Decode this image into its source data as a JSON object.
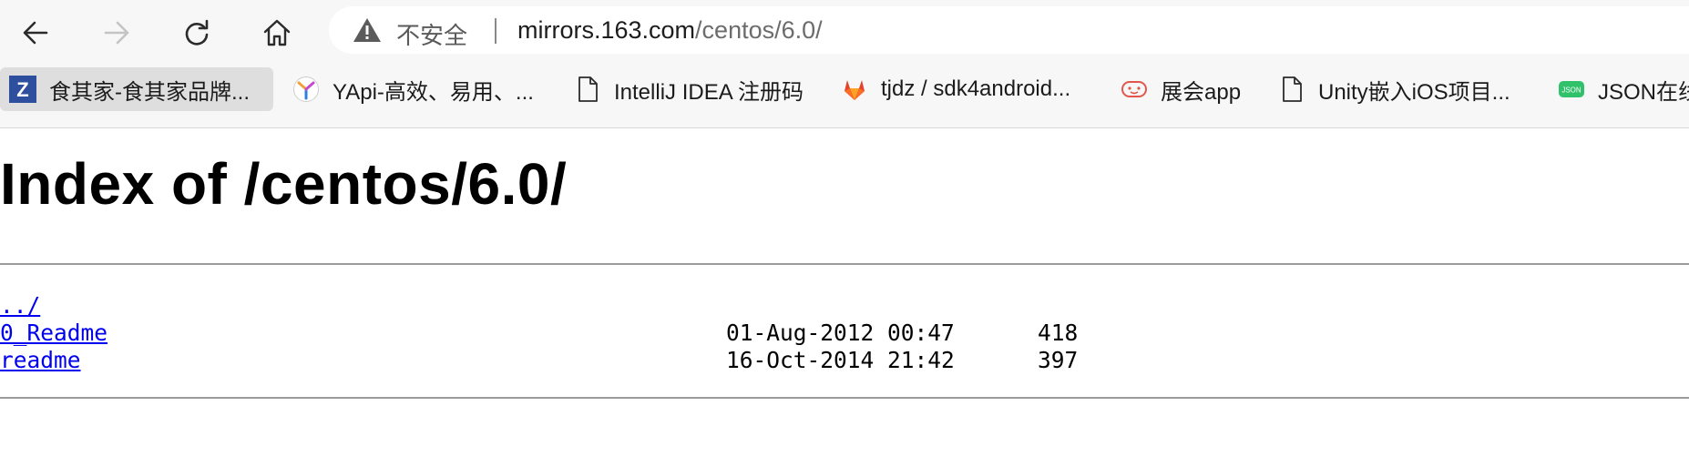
{
  "browser": {
    "security_label": "不安全",
    "url_host": "mirrors.163.com",
    "url_path": "/centos/6.0/"
  },
  "bookmarks": [
    {
      "label": "食其家-食其家品牌...",
      "icon": "z-logo-icon",
      "icon_color": "#2d4f9e"
    },
    {
      "label": "YApi-高效、易用、...",
      "icon": "yapi-logo-icon"
    },
    {
      "label": "IntelliJ IDEA 注册码",
      "icon": "page-icon"
    },
    {
      "label": "tjdz / sdk4android...",
      "icon": "gitlab-icon",
      "icon_color": "#e24329"
    },
    {
      "label": "展会app",
      "icon": "face-icon",
      "icon_color": "#e2574c"
    },
    {
      "label": "Unity嵌入iOS项目...",
      "icon": "page-icon"
    },
    {
      "label": "JSON在线",
      "icon": "json-icon",
      "icon_color": "#2fc26a"
    }
  ],
  "page": {
    "title": "Index of /centos/6.0/",
    "parent_link": "../",
    "files": [
      {
        "name": "0_Readme",
        "date": "01-Aug-2012 00:47",
        "size": "418"
      },
      {
        "name": "readme",
        "date": "16-Oct-2014 21:42",
        "size": "397"
      }
    ]
  },
  "colors": {
    "link": "#0000ee",
    "toolbar_bg": "#f7f7f7"
  }
}
